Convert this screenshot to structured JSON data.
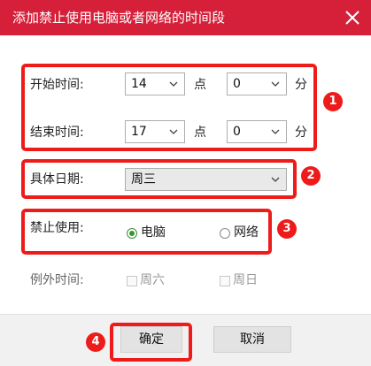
{
  "dialog": {
    "title": "添加禁止使用电脑或者网络的时间段"
  },
  "start_time": {
    "label": "开始时间:",
    "hour": "14",
    "hour_unit": "点",
    "minute": "0",
    "minute_unit": "分"
  },
  "end_time": {
    "label": "结束时间:",
    "hour": "17",
    "hour_unit": "点",
    "minute": "0",
    "minute_unit": "分"
  },
  "date": {
    "label": "具体日期:",
    "value": "周三"
  },
  "block": {
    "label": "禁止使用:",
    "options": [
      "电脑",
      "网络"
    ],
    "selected": "电脑"
  },
  "exceptions": {
    "label": "例外时间:",
    "options": [
      "周六",
      "周日"
    ]
  },
  "buttons": {
    "ok": "确定",
    "cancel": "取消"
  },
  "annotations": [
    "1",
    "2",
    "3",
    "4"
  ],
  "colors": {
    "titlebar": "#d6203a",
    "highlight": "#ee1b1b",
    "radio_selected": "#2e9b2e"
  }
}
